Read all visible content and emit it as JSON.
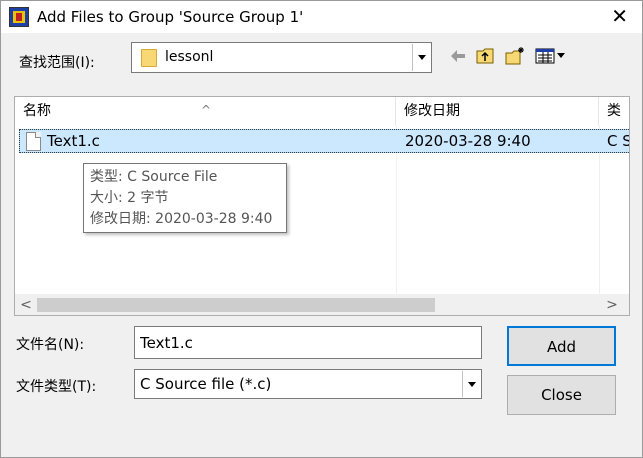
{
  "window": {
    "title": "Add Files to Group 'Source Group 1'",
    "close_glyph": "✕"
  },
  "lookin": {
    "label": "查找范围(I):",
    "value": "lessonl"
  },
  "list": {
    "columns": [
      "名称",
      "修改日期",
      "类"
    ],
    "rows": [
      {
        "name": "Text1.c",
        "date": "2020-03-28 9:40",
        "type": "C S"
      }
    ]
  },
  "tooltip": {
    "line1": "类型: C Source File",
    "line2": "大小: 2 字节",
    "line3": "修改日期: 2020-03-28 9:40"
  },
  "scrollbar": {
    "left_glyph": "<",
    "right_glyph": ">"
  },
  "filename": {
    "label": "文件名(N):",
    "value": "Text1.c"
  },
  "filetype": {
    "label": "文件类型(T):",
    "value": "C Source file (*.c)"
  },
  "buttons": {
    "add": "Add",
    "close": "Close"
  },
  "icons": [
    "app-icon",
    "folder-icon",
    "back-icon",
    "up-folder-icon",
    "new-folder-icon",
    "view-menu-icon",
    "file-icon"
  ]
}
